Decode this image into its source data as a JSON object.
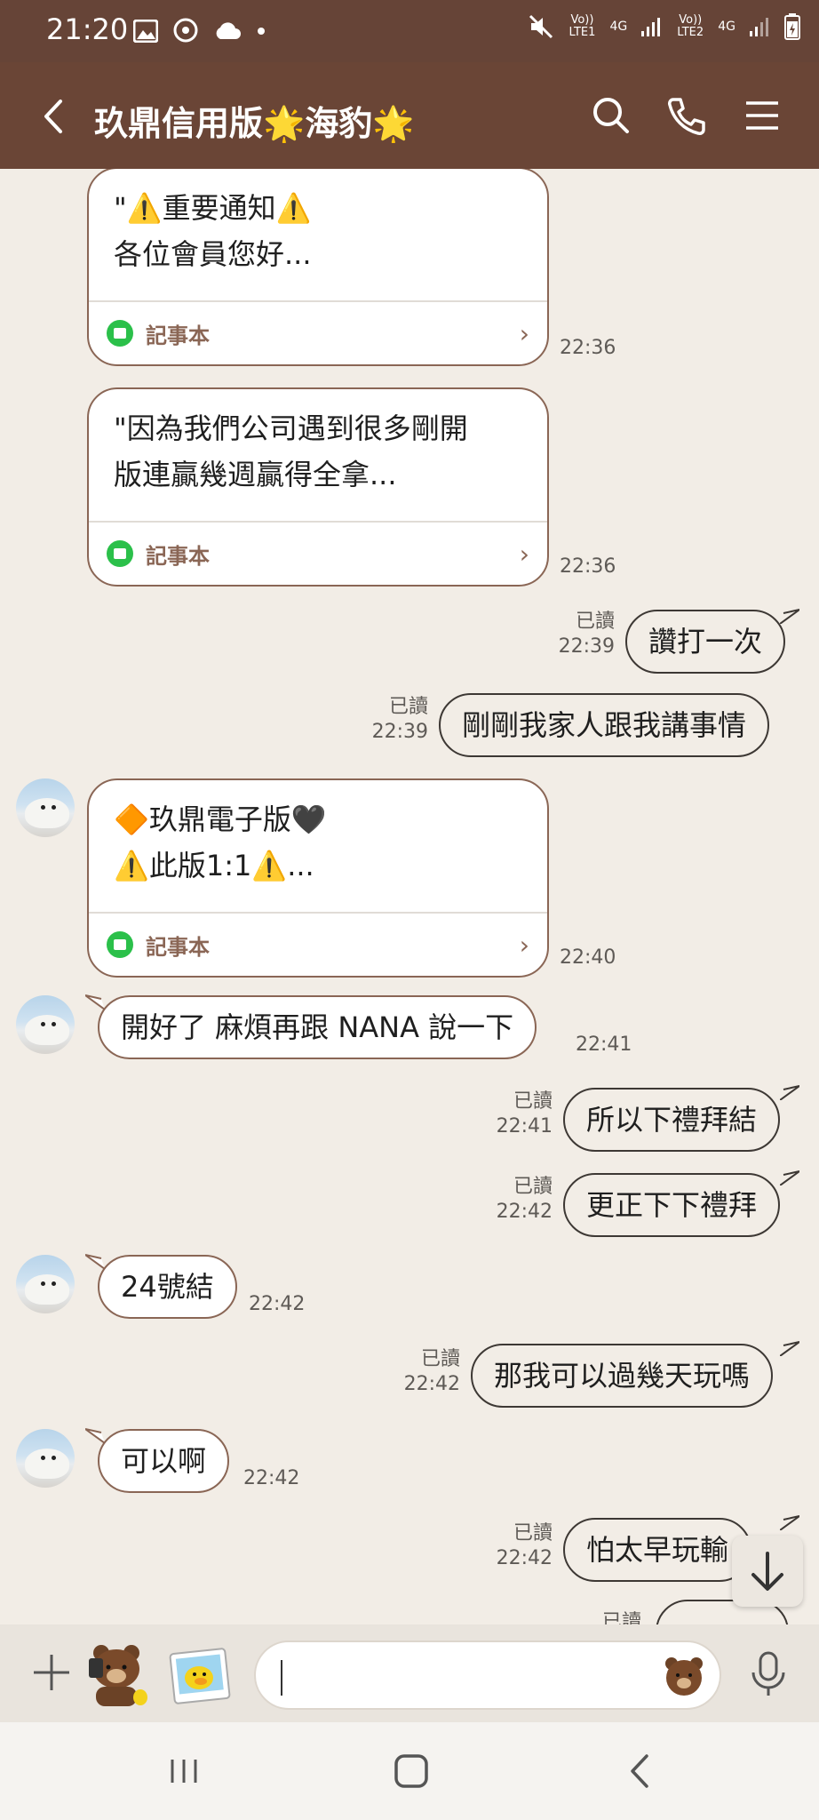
{
  "status_bar": {
    "time": "21:20",
    "sim1": "Vo)) LTE1",
    "sim2": "Vo)) LTE2",
    "network": "4G"
  },
  "header": {
    "title": "玖鼎信用版🌟海豹🌟"
  },
  "messages": [
    {
      "type": "note",
      "text": "\"⚠️重要通知⚠️\n各位會員您好...",
      "label": "記事本",
      "time": "22:36"
    },
    {
      "type": "note",
      "text": "\"因為我們公司遇到很多剛開\n版連贏幾週贏得全拿...",
      "label": "記事本",
      "time": "22:36"
    },
    {
      "type": "out",
      "text": "讚打一次",
      "read": "已讀",
      "time": "22:39"
    },
    {
      "type": "out",
      "text": "剛剛我家人跟我講事情",
      "read": "已讀",
      "time": "22:39"
    },
    {
      "type": "note",
      "text": "🔶玖鼎電子版🖤\n⚠️此版1:1⚠️...",
      "label": "記事本",
      "time": "22:40"
    },
    {
      "type": "in",
      "text": "開好了 麻煩再跟 NANA 說一下",
      "time": "22:41"
    },
    {
      "type": "out",
      "text": "所以下禮拜結",
      "read": "已讀",
      "time": "22:41"
    },
    {
      "type": "out",
      "text": "更正下下禮拜",
      "read": "已讀",
      "time": "22:42"
    },
    {
      "type": "in",
      "text": "24號結",
      "time": "22:42"
    },
    {
      "type": "out",
      "text": "那我可以過幾天玩嗎",
      "read": "已讀",
      "time": "22:42"
    },
    {
      "type": "in",
      "text": "可以啊",
      "time": "22:42"
    },
    {
      "type": "out",
      "text": "怕太早玩輸",
      "read": "已讀",
      "time": "22:42"
    },
    {
      "type": "out",
      "text": "",
      "read": "已讀",
      "time": ""
    }
  ],
  "input": {
    "placeholder": ""
  },
  "colors": {
    "status_bar": "#664437",
    "header": "#6a4536",
    "chat_bg": "#f2ede6",
    "note_icon": "#2bc04a",
    "bubble_border": "#3d3834"
  },
  "icons": [
    "back-icon",
    "search-icon",
    "phone-icon",
    "menu-icon",
    "plus-icon",
    "brown-bear-sticker-icon",
    "sally-sticker-icon",
    "bear-emoji-icon",
    "mic-icon",
    "scroll-down-icon",
    "recents-icon",
    "home-icon",
    "nav-back-icon"
  ]
}
